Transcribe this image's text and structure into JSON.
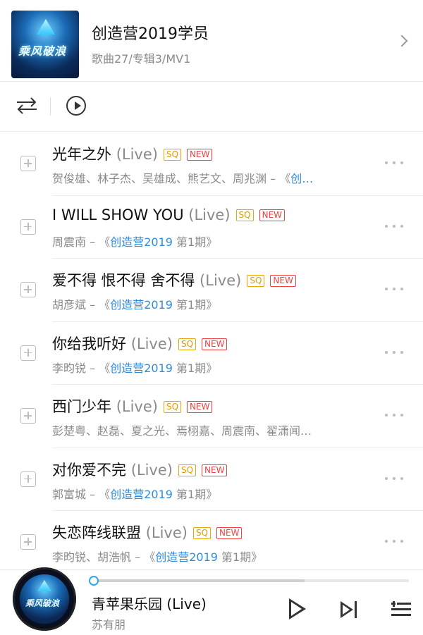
{
  "artist": {
    "name": "创造营2019学员",
    "stats": "歌曲27/专辑3/MV1",
    "cover_text": "乘风破浪"
  },
  "songs": [
    {
      "title": "光年之外",
      "live": "(Live)",
      "sq": "SQ",
      "new": "NEW",
      "artists": "贺俊雄、林子杰、吴雄成、熊艺文、周兆渊",
      "sep": " – 《",
      "album": "创…",
      "suffix": ""
    },
    {
      "title": "I WILL SHOW YOU",
      "live": "(Live)",
      "sq": "SQ",
      "new": "NEW",
      "artists": "周震南",
      "sep": " – 《",
      "album": "创造营2019",
      "suffix": " 第1期》"
    },
    {
      "title": "爱不得 恨不得 舍不得",
      "live": "(Live)",
      "sq": "SQ",
      "new": "NEW",
      "artists": "胡彦斌",
      "sep": " – 《",
      "album": "创造营2019",
      "suffix": " 第1期》"
    },
    {
      "title": "你给我听好",
      "live": "(Live)",
      "sq": "SQ",
      "new": "NEW",
      "artists": "李昀锐",
      "sep": " – 《",
      "album": "创造营2019",
      "suffix": " 第1期》"
    },
    {
      "title": "西门少年",
      "live": "(Live)",
      "sq": "SQ",
      "new": "NEW",
      "artists": "彭楚粤、赵磊、夏之光、焉栩嘉、周震南、翟潇闻…",
      "sep": "",
      "album": "",
      "suffix": ""
    },
    {
      "title": "对你爱不完",
      "live": "(Live)",
      "sq": "SQ",
      "new": "NEW",
      "artists": "郭富城",
      "sep": " – 《",
      "album": "创造营2019",
      "suffix": " 第1期》"
    },
    {
      "title": "失恋阵线联盟",
      "live": "(Live)",
      "sq": "SQ",
      "new": "NEW",
      "artists": "李昀锐、胡浩帆",
      "sep": " – 《",
      "album": "创造营2019",
      "suffix": " 第1期》"
    }
  ],
  "player": {
    "title": "青苹果乐园 (Live)",
    "artist": "苏有朋",
    "cover_text": "乘风破浪",
    "progress": 0.0,
    "buffered": 0.67
  },
  "colors": {
    "accent_blue": "#2d8cdf",
    "sq_gold": "#e09b00",
    "new_red": "#f04141"
  },
  "icons": [
    "chevron-right-icon",
    "shuffle-icon",
    "play-circle-icon",
    "add-icon",
    "more-icon",
    "play-icon",
    "next-icon",
    "playlist-icon"
  ]
}
